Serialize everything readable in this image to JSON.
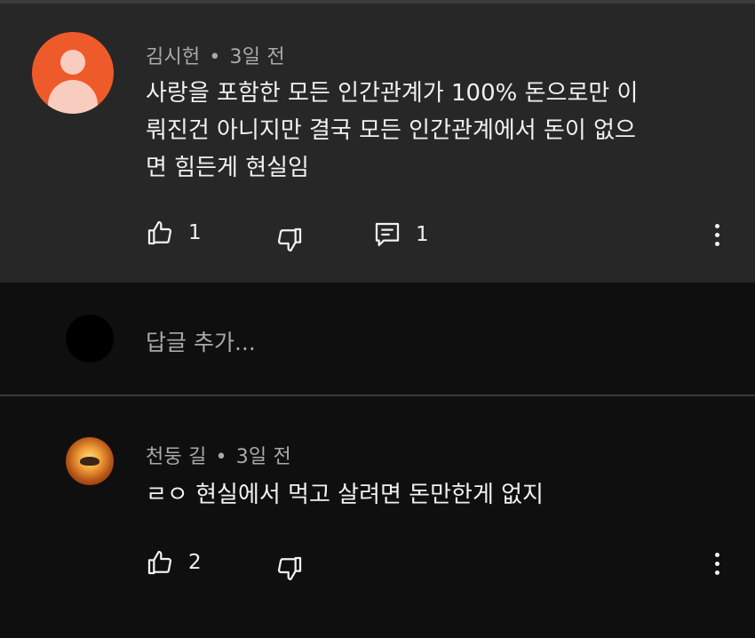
{
  "comment": {
    "author": "김시헌",
    "time": "3일 전",
    "lines": [
      "사랑을 포함한 모든 인간관계가 100% 돈으로만 이",
      "뤄진건 아니지만 결국 모든 인간관계에서 돈이 없으",
      "면 힘든게 현실임"
    ],
    "like_count": "1",
    "reply_count": "1"
  },
  "reply_input": {
    "placeholder": "답글 추가..."
  },
  "reply": {
    "author": "천둥 길",
    "time": "3일 전",
    "text": "ㄹㅇ 현실에서 먹고 살려면 돈만한게 없지",
    "like_count": "2"
  },
  "separator": "•",
  "colors": {
    "avatar_orange": "#ef5a2a",
    "highlight_bg": "#272727",
    "background": "#0f0f0f"
  },
  "icons": [
    "like-icon",
    "dislike-icon",
    "reply-icon",
    "more-vert-icon"
  ]
}
